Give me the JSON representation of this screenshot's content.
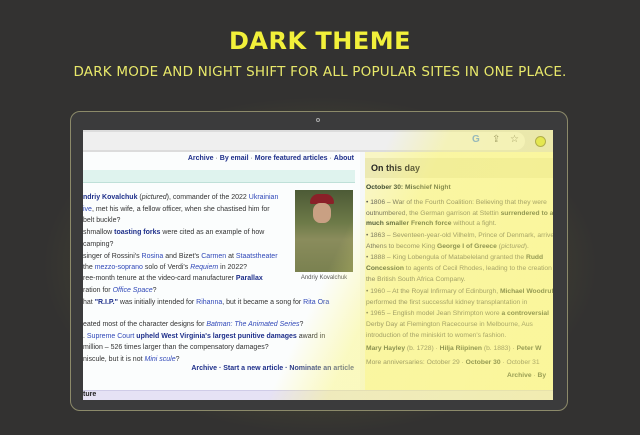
{
  "promo": {
    "title": "DARK THEME",
    "subtitle": "DARK MODE AND NIGHT SHIFT FOR ALL POPULAR SITES IN ONE PLACE."
  },
  "colors": {
    "accent": "#f2f03a",
    "background": "#333231",
    "highlight": "#f9f6c4"
  },
  "browser": {
    "icons": [
      "google-icon",
      "share-icon",
      "star-icon",
      "dark-theme-extension-icon"
    ],
    "google_glyph": "G",
    "share_glyph": "⇪",
    "star_glyph": "☆"
  },
  "dyk": {
    "topnav": [
      "Archive",
      "By email",
      "More featured articles",
      "About"
    ],
    "lines": [
      [
        {
          "t": "ndriy Kovalchuk",
          "s": "b"
        },
        {
          "t": " (",
          "s": "n"
        },
        {
          "t": "pictured",
          "s": "i"
        },
        {
          "t": "), commander of the 2022 ",
          "s": "n"
        },
        {
          "t": "Ukrainian",
          "s": "l"
        }
      ],
      [
        {
          "t": "ive",
          "s": "l"
        },
        {
          "t": ", met his wife, a fellow officer, when she chastised him for",
          "s": "n"
        }
      ],
      [
        {
          "t": "belt buckle?",
          "s": "n"
        }
      ],
      [
        {
          "t": "shmallow ",
          "s": "n"
        },
        {
          "t": "toasting forks",
          "s": "b"
        },
        {
          "t": " were cited as an example of how",
          "s": "n"
        }
      ],
      [
        {
          "t": "camping?",
          "s": "n"
        }
      ],
      [
        {
          "t": "singer of Rossini's ",
          "s": "n"
        },
        {
          "t": "Rosina",
          "s": "l"
        },
        {
          "t": " and Bizet's ",
          "s": "n"
        },
        {
          "t": "Carmen",
          "s": "l"
        },
        {
          "t": " at ",
          "s": "n"
        },
        {
          "t": "Staatstheater",
          "s": "l"
        }
      ],
      [
        {
          "t": "the ",
          "s": "n"
        },
        {
          "t": "mezzo-soprano",
          "s": "l"
        },
        {
          "t": " solo of Verdi's ",
          "s": "n"
        },
        {
          "t": "Requiem",
          "s": "li"
        },
        {
          "t": " in 2022?",
          "s": "n"
        }
      ],
      [
        {
          "t": "ree-month tenure at the video-card manufacturer ",
          "s": "n"
        },
        {
          "t": "Parallax",
          "s": "b"
        }
      ],
      [
        {
          "t": "ration for ",
          "s": "n"
        },
        {
          "t": "Office Space",
          "s": "li"
        },
        {
          "t": "?",
          "s": "n"
        }
      ],
      [
        {
          "t": "hat ",
          "s": "n"
        },
        {
          "t": "\"R.I.P.\"",
          "s": "b"
        },
        {
          "t": " was initially intended for ",
          "s": "n"
        },
        {
          "t": "Rihanna",
          "s": "l"
        },
        {
          "t": ", but it became a song for ",
          "s": "n"
        },
        {
          "t": "Rita Ora",
          "s": "l"
        }
      ],
      [
        {
          "t": "eated most of the character designs for ",
          "s": "n"
        },
        {
          "t": "Batman: The Animated Series",
          "s": "li"
        },
        {
          "t": "?",
          "s": "n"
        }
      ],
      [
        {
          "t": ". ",
          "s": "n"
        },
        {
          "t": "Supreme Court",
          "s": "l"
        },
        {
          "t": " upheld West Virginia's largest punitive damages",
          "s": "b"
        },
        {
          "t": " award in",
          "s": "n"
        }
      ],
      [
        {
          "t": "million – 526 times larger than the compensatory damages?",
          "s": "n"
        }
      ],
      [
        {
          "t": "niscule, but it is not ",
          "s": "n"
        },
        {
          "t": "Mini scule",
          "s": "li"
        },
        {
          "t": "?",
          "s": "n"
        }
      ]
    ],
    "caption": "Andriy Kovalchuk",
    "botnav": [
      "Archive",
      "Start a new article",
      "Nominate an article"
    ],
    "next_section": "ture"
  },
  "otd": {
    "heading": "On this day",
    "lines": [
      [
        {
          "t": "October 30: ",
          "s": "b"
        },
        {
          "t": "Mischief Night",
          "s": "b"
        }
      ],
      [
        {
          "t": "• 1806 – War of the Fourth Coalition: Believing that they were",
          "s": "n"
        }
      ],
      [
        {
          "t": "   outnumbered, the German garrison at Stettin ",
          "s": "n"
        },
        {
          "t": "surrendered to a",
          "s": "b"
        }
      ],
      [
        {
          "t": "   much smaller French force",
          "s": "b"
        },
        {
          "t": " without a fight.",
          "s": "n"
        }
      ],
      [
        {
          "t": "• 1863 – Seventeen-year-old Vilhelm, Prince of Denmark, arrived in",
          "s": "n"
        }
      ],
      [
        {
          "t": "   Athens to become King ",
          "s": "n"
        },
        {
          "t": "George I of Greece",
          "s": "b"
        },
        {
          "t": " (",
          "s": "n"
        },
        {
          "t": "pictured",
          "s": "i"
        },
        {
          "t": ").",
          "s": "n"
        }
      ],
      [
        {
          "t": "• 1888 – King Lobengula of Matabeleland granted the ",
          "s": "n"
        },
        {
          "t": "Rudd",
          "s": "b"
        }
      ],
      [
        {
          "t": "   Concession",
          "s": "b"
        },
        {
          "t": " to agents of Cecil Rhodes, leading to the creation of",
          "s": "n"
        }
      ],
      [
        {
          "t": "   the British South Africa Company.",
          "s": "n"
        }
      ],
      [
        {
          "t": "• 1960 – At the Royal Infirmary of Edinburgh, ",
          "s": "n"
        },
        {
          "t": "Michael Woodruff",
          "s": "b"
        }
      ],
      [
        {
          "t": "   performed the first successful kidney transplantation in",
          "s": "n"
        }
      ],
      [
        {
          "t": "• 1965 – English model Jean Shrimpton wore ",
          "s": "n"
        },
        {
          "t": "a controversial",
          "s": "b"
        }
      ],
      [
        {
          "t": "   Derby Day at Flemington Racecourse in Melbourne, Aus",
          "s": "n"
        }
      ],
      [
        {
          "t": "   introduction of the miniskirt to women's fashion.",
          "s": "n"
        }
      ],
      [
        {
          "t": "Mary Hayley",
          "s": "b"
        },
        {
          "t": " (b. 1728) · ",
          "s": "n"
        },
        {
          "t": "Hilja Riipinen",
          "s": "b"
        },
        {
          "t": " (b. 1883) · ",
          "s": "n"
        },
        {
          "t": "Peter W",
          "s": "b"
        }
      ],
      [
        {
          "t": "More anniversaries: October 29 · ",
          "s": "n"
        },
        {
          "t": "October 30",
          "s": "b"
        },
        {
          "t": " · October 31",
          "s": "n"
        }
      ],
      [
        {
          "t": "Archive",
          "s": "b"
        },
        {
          "t": " · ",
          "s": "n"
        },
        {
          "t": "By",
          "s": "b"
        }
      ]
    ]
  }
}
